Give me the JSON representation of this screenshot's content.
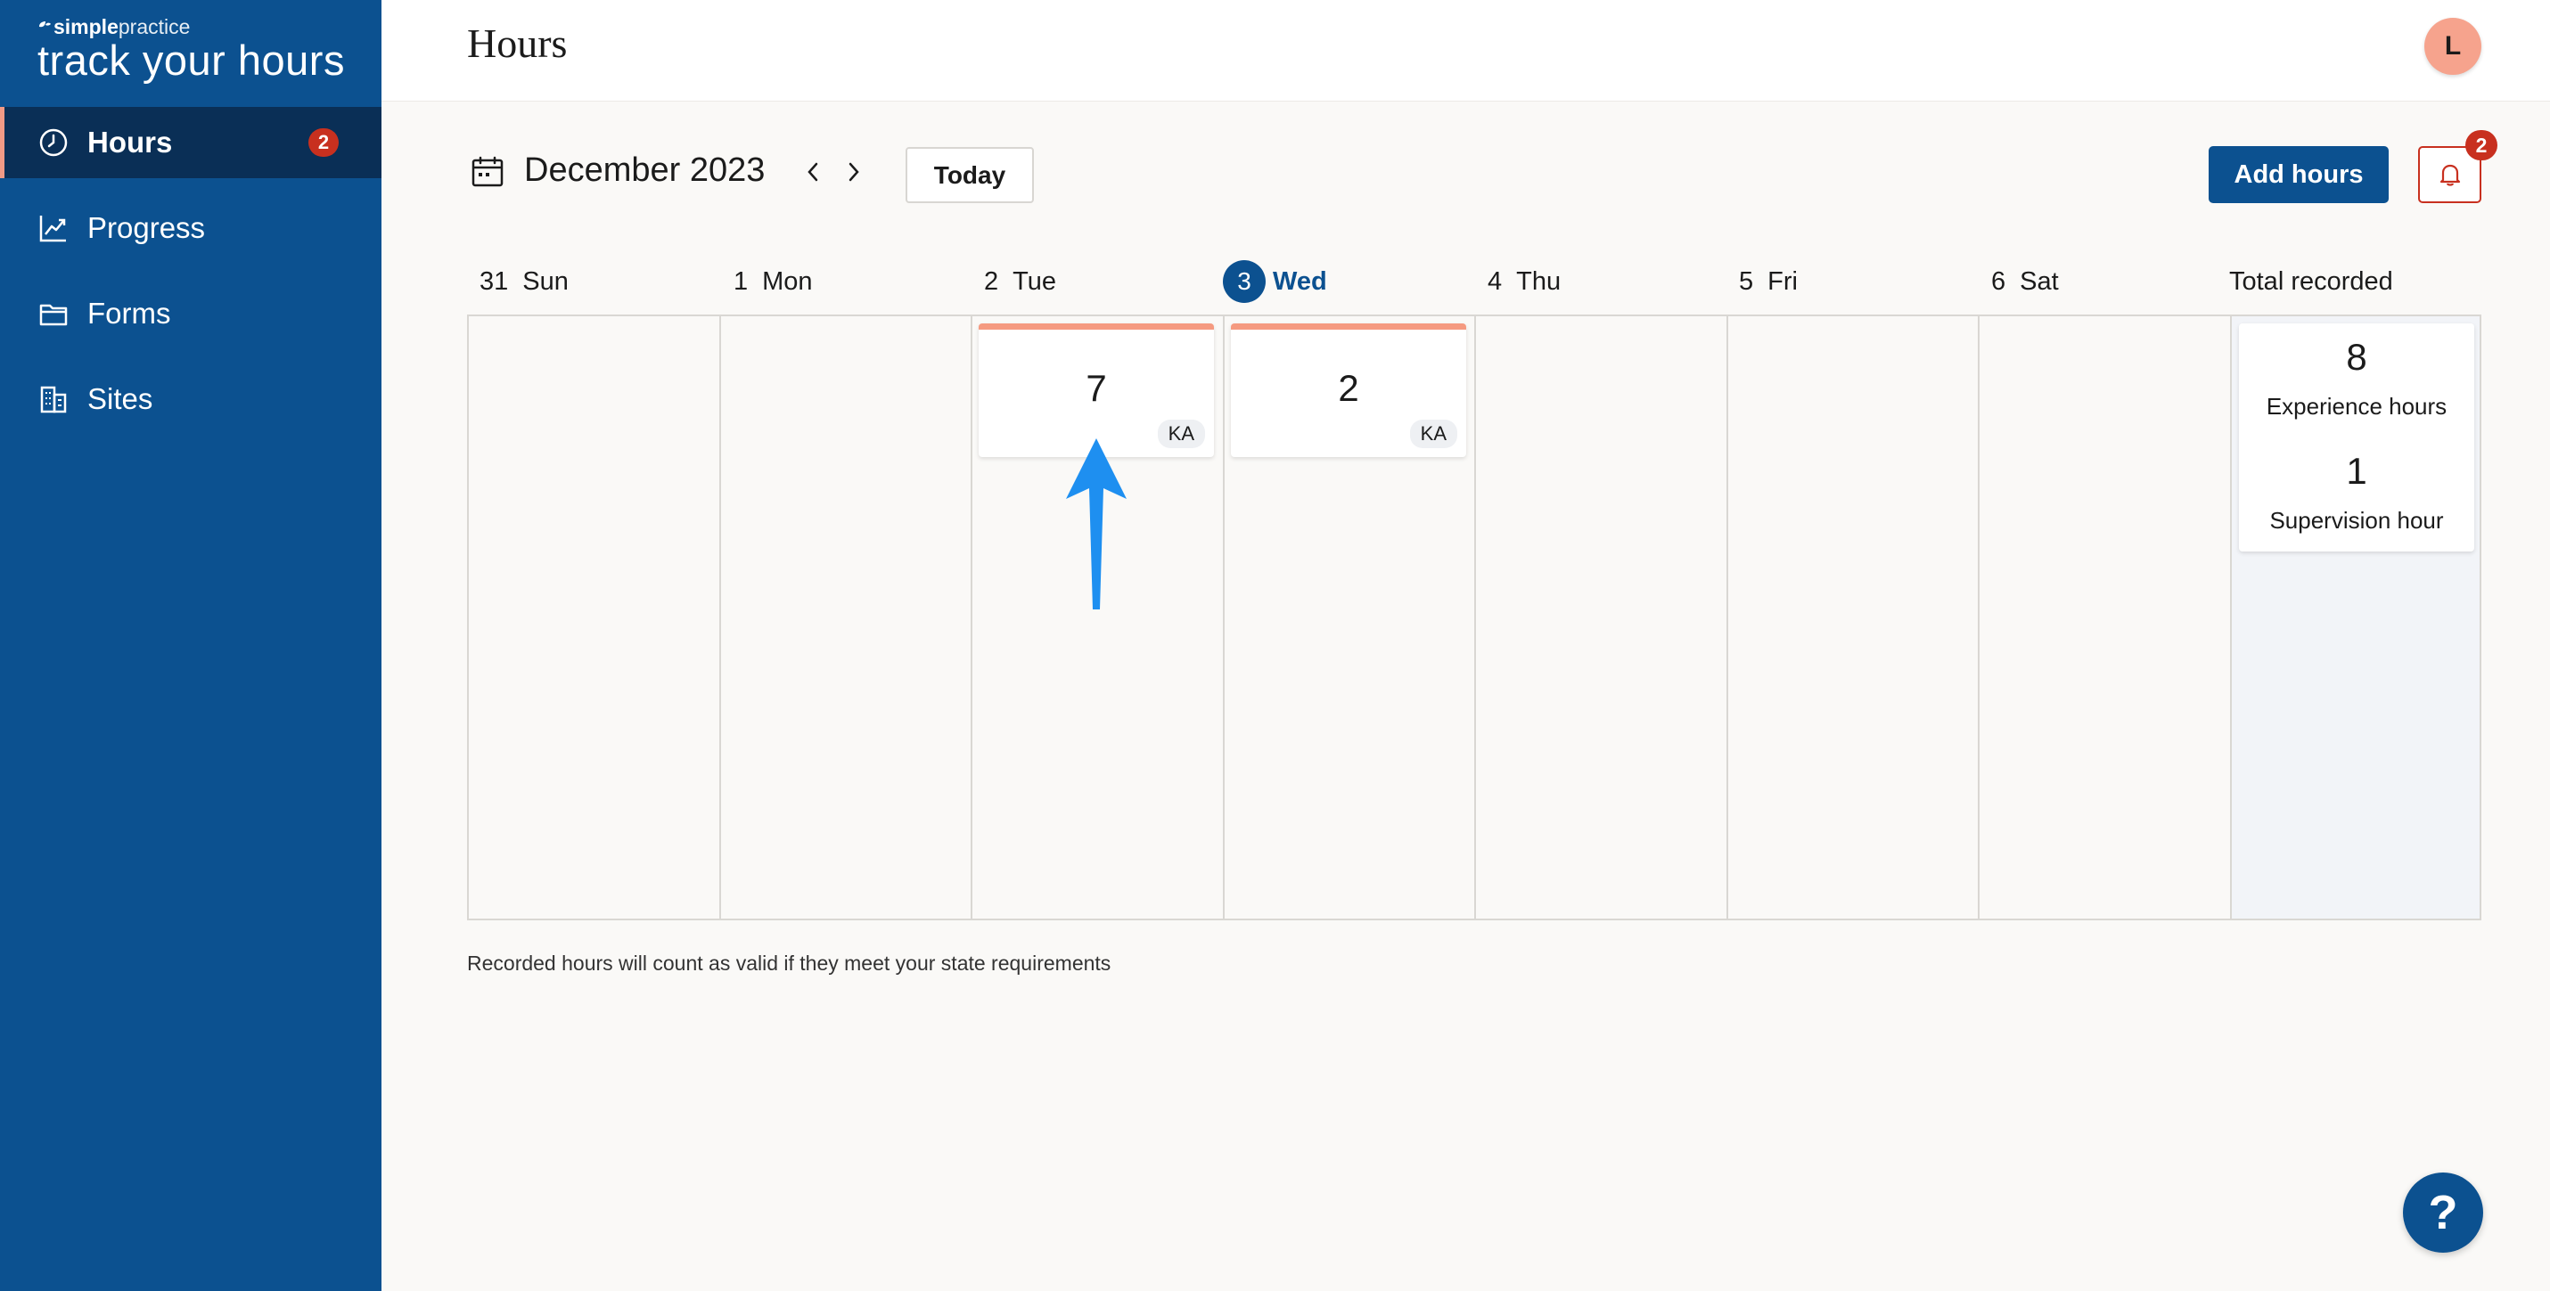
{
  "brand": {
    "small_bold": "simple",
    "small_light": "practice",
    "big": "track your hours"
  },
  "sidebar": {
    "items": [
      {
        "label": "Hours",
        "icon": "clock-icon",
        "badge": "2",
        "active": true
      },
      {
        "label": "Progress",
        "icon": "chart-icon"
      },
      {
        "label": "Forms",
        "icon": "folder-icon"
      },
      {
        "label": "Sites",
        "icon": "building-icon"
      }
    ]
  },
  "header": {
    "title": "Hours",
    "avatar_initial": "L"
  },
  "toolbar": {
    "month": "December 2023",
    "prev_icon": "chevron-left-icon",
    "next_icon": "chevron-right-icon",
    "today_label": "Today",
    "add_hours_label": "Add hours",
    "notification_count": "2"
  },
  "week": {
    "days": [
      {
        "num": "31",
        "name": "Sun"
      },
      {
        "num": "1",
        "name": "Mon"
      },
      {
        "num": "2",
        "name": "Tue"
      },
      {
        "num": "3",
        "name": "Wed",
        "today": true
      },
      {
        "num": "4",
        "name": "Thu"
      },
      {
        "num": "5",
        "name": "Fri"
      },
      {
        "num": "6",
        "name": "Sat"
      }
    ],
    "total_label": "Total recorded",
    "entries": [
      {
        "day": "Tue",
        "hours": "7",
        "tag": "KA"
      },
      {
        "day": "Wed",
        "hours": "2",
        "tag": "KA"
      }
    ],
    "totals": {
      "experience_value": "8",
      "experience_label": "Experience hours",
      "supervision_value": "1",
      "supervision_label": "Supervision hour"
    }
  },
  "footnote": "Recorded hours will count as valid if they meet your state requirements",
  "help_label": "?",
  "colors": {
    "primary": "#0c5190",
    "sidebar_active": "#0a2f56",
    "accent": "#f59a80",
    "alert": "#c8301f",
    "annotation_arrow": "#1e8ff0"
  }
}
